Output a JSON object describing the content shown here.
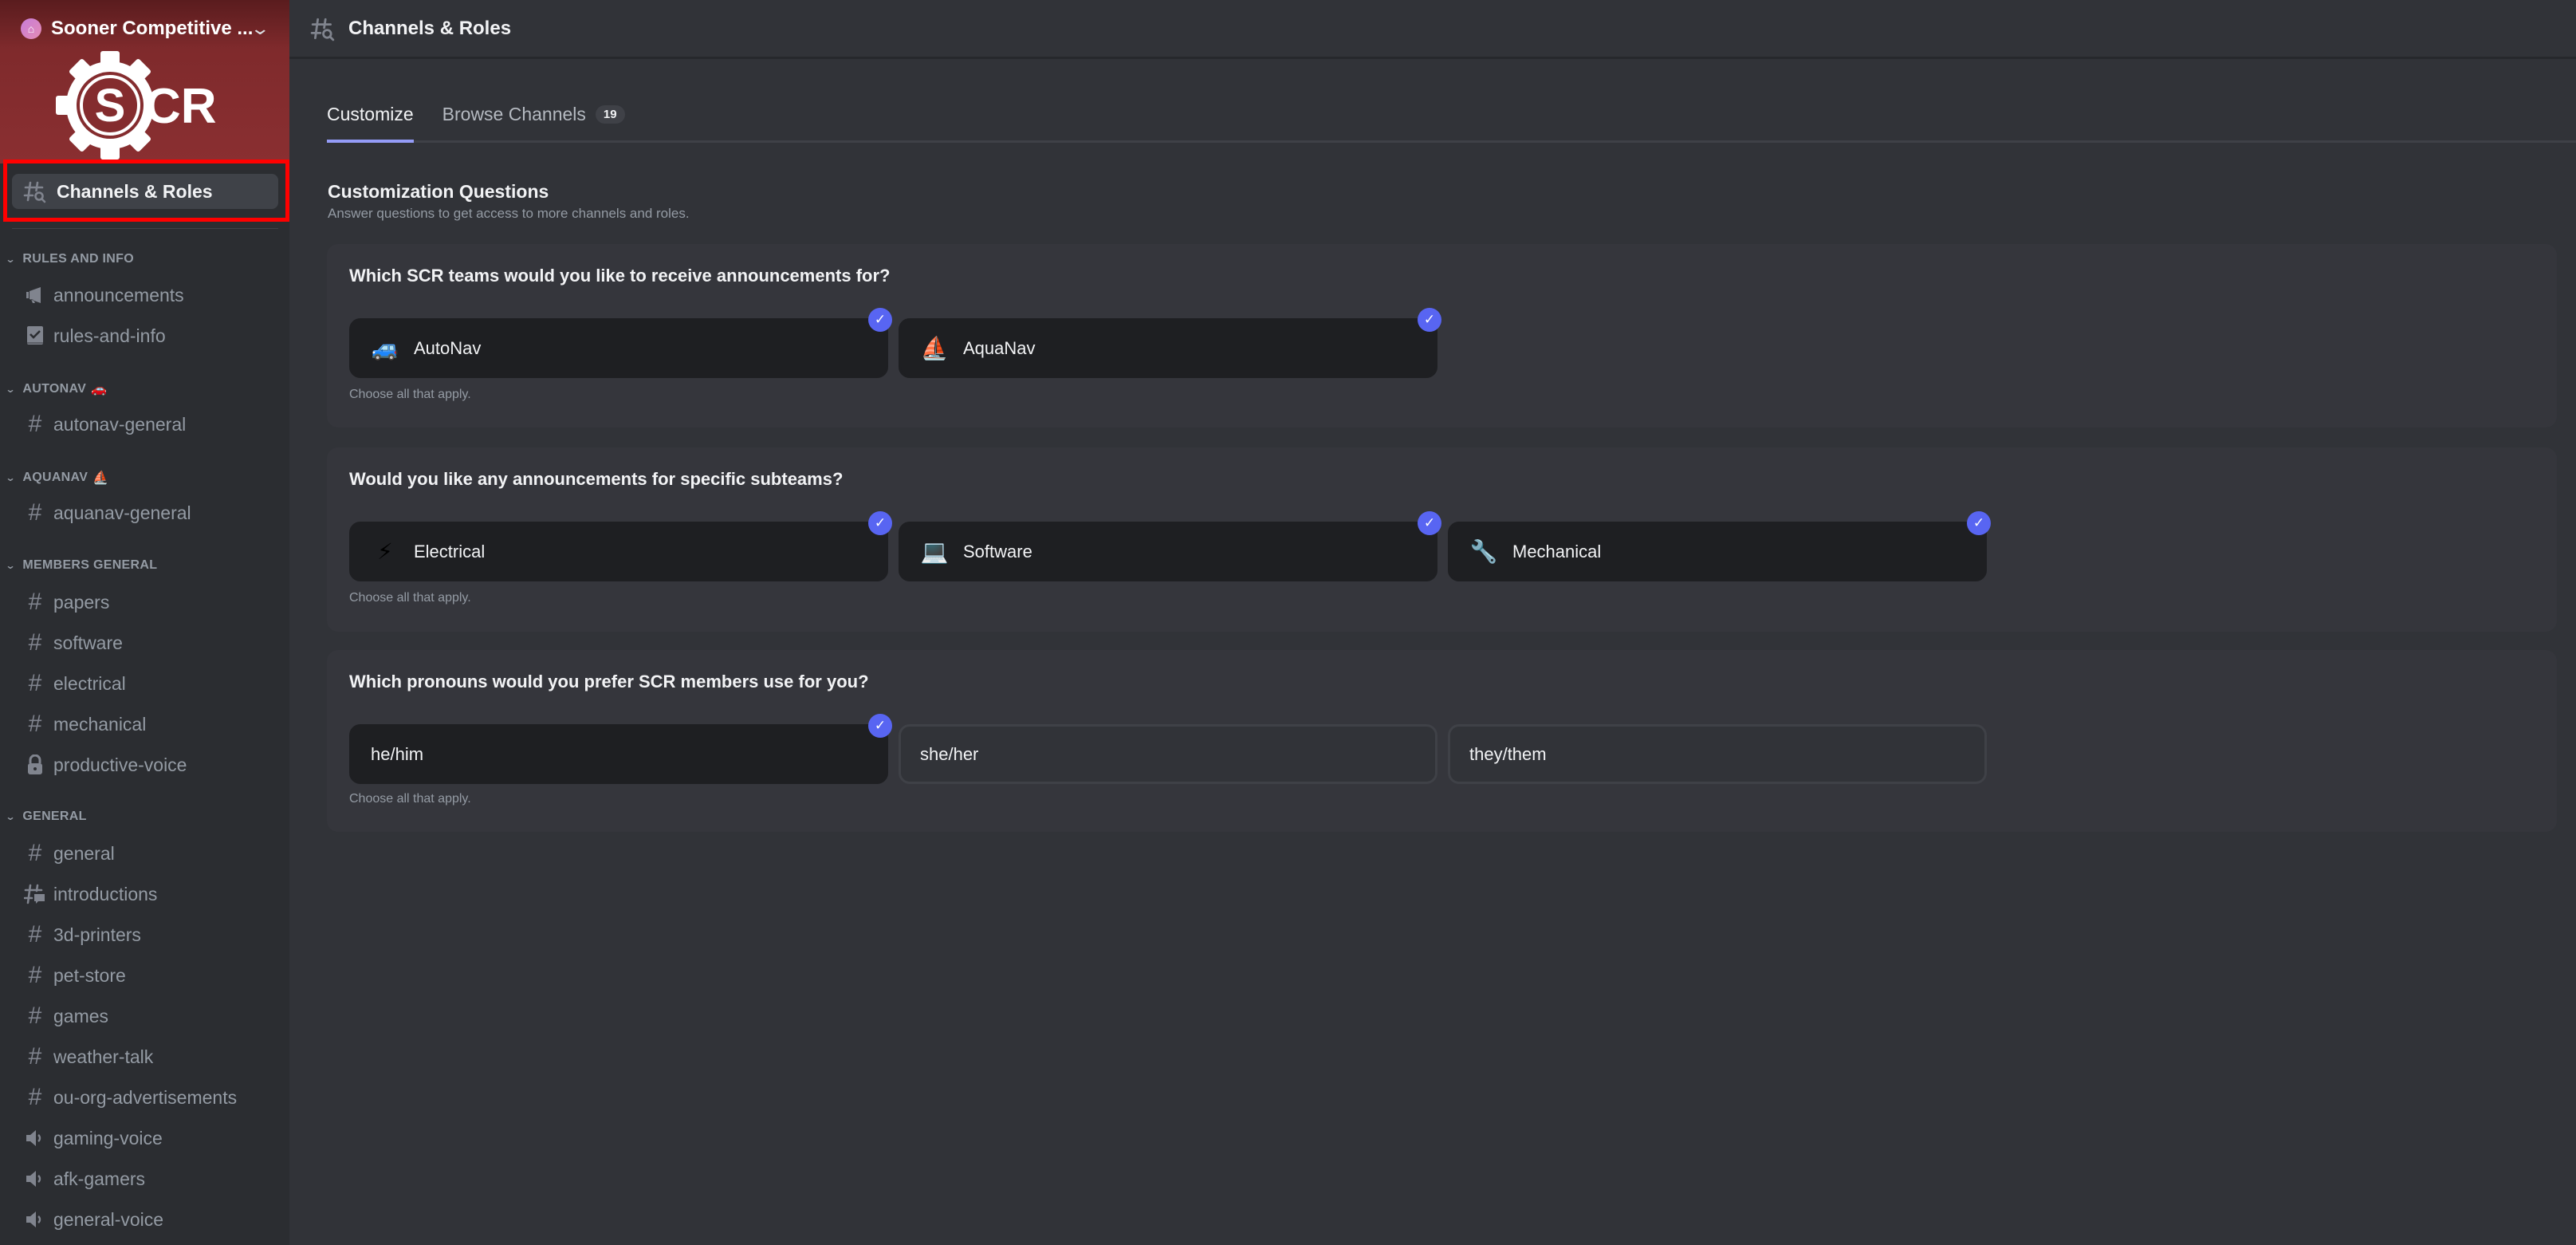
{
  "server": {
    "name": "Sooner Competitive ...",
    "logo_text": "SCR"
  },
  "sidebar": {
    "channels_roles_label": "Channels & Roles",
    "categories": [
      {
        "label": "RULES AND INFO",
        "emoji": "",
        "channels": [
          {
            "name": "announcements",
            "icon": "megaphone-icon"
          },
          {
            "name": "rules-and-info",
            "icon": "rules-book-icon"
          }
        ]
      },
      {
        "label": "AUTONAV",
        "emoji": "🚗",
        "channels": [
          {
            "name": "autonav-general",
            "icon": "hash-icon"
          }
        ]
      },
      {
        "label": "AQUANAV",
        "emoji": "⛵",
        "channels": [
          {
            "name": "aquanav-general",
            "icon": "hash-icon"
          }
        ]
      },
      {
        "label": "MEMBERS GENERAL",
        "emoji": "",
        "channels": [
          {
            "name": "papers",
            "icon": "hash-icon"
          },
          {
            "name": "software",
            "icon": "hash-icon"
          },
          {
            "name": "electrical",
            "icon": "hash-icon"
          },
          {
            "name": "mechanical",
            "icon": "hash-icon"
          },
          {
            "name": "productive-voice",
            "icon": "lock-icon"
          }
        ]
      },
      {
        "label": "GENERAL",
        "emoji": "",
        "channels": [
          {
            "name": "general",
            "icon": "hash-icon"
          },
          {
            "name": "introductions",
            "icon": "forum-icon"
          },
          {
            "name": "3d-printers",
            "icon": "hash-icon"
          },
          {
            "name": "pet-store",
            "icon": "hash-icon"
          },
          {
            "name": "games",
            "icon": "hash-icon"
          },
          {
            "name": "weather-talk",
            "icon": "hash-icon"
          },
          {
            "name": "ou-org-advertisements",
            "icon": "hash-icon"
          },
          {
            "name": "gaming-voice",
            "icon": "speaker-icon"
          },
          {
            "name": "afk-gamers",
            "icon": "speaker-icon"
          },
          {
            "name": "general-voice",
            "icon": "speaker-icon"
          }
        ]
      }
    ]
  },
  "header": {
    "title": "Channels & Roles"
  },
  "tabs": [
    {
      "label": "Customize",
      "active": true
    },
    {
      "label": "Browse Channels",
      "active": false,
      "badge": "19"
    }
  ],
  "customization": {
    "title": "Customization Questions",
    "subtitle": "Answer questions to get access to more channels and roles.",
    "questions": [
      {
        "question": "Which SCR teams would you like to receive announcements for?",
        "hint": "Choose all that apply.",
        "options": [
          {
            "label": "AutoNav",
            "emoji": "🚙",
            "selected": true
          },
          {
            "label": "AquaNav",
            "emoji": "⛵",
            "selected": true
          }
        ]
      },
      {
        "question": "Would you like any announcements for specific subteams?",
        "hint": "Choose all that apply.",
        "options": [
          {
            "label": "Electrical",
            "emoji": "⚡",
            "selected": true
          },
          {
            "label": "Software",
            "emoji": "💻",
            "selected": true
          },
          {
            "label": "Mechanical",
            "emoji": "🔧",
            "selected": true
          }
        ]
      },
      {
        "question": "Which pronouns would you prefer SCR members use for you?",
        "hint": "Choose all that apply.",
        "options": [
          {
            "label": "he/him",
            "emoji": "",
            "selected": true
          },
          {
            "label": "she/her",
            "emoji": "",
            "selected": false
          },
          {
            "label": "they/them",
            "emoji": "",
            "selected": false
          }
        ]
      }
    ]
  },
  "colors": {
    "accent": "#5865f2",
    "tab_underline": "#949cf7",
    "banner": "#8a2f31",
    "highlight_outline": "#ff0000"
  }
}
